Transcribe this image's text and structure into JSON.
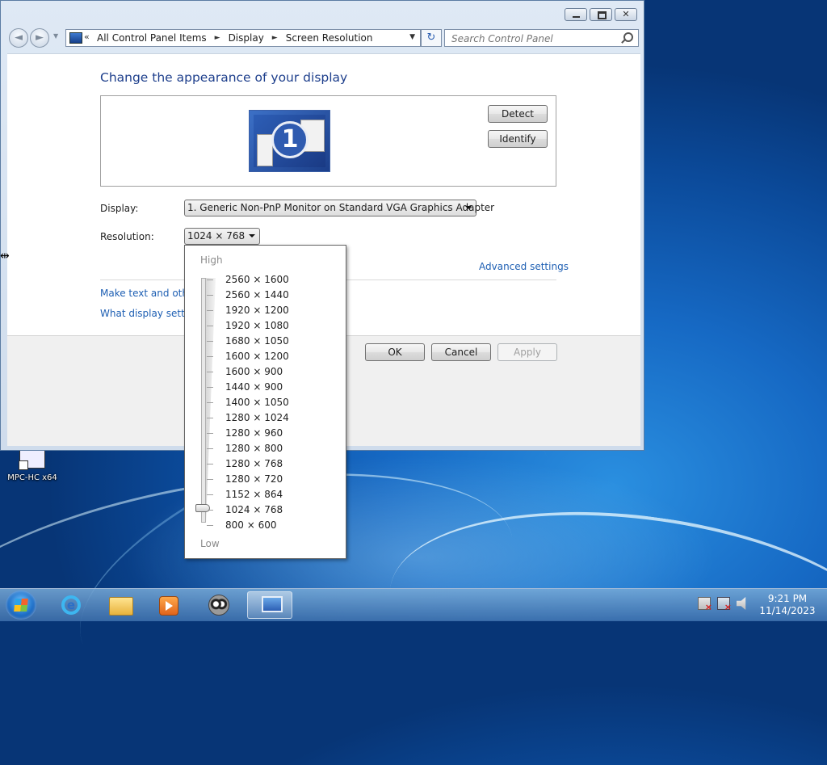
{
  "window": {
    "address": {
      "back_glyph": "◄",
      "forward_glyph": "►",
      "chevron": "«",
      "crumbs": [
        "All Control Panel Items",
        "Display",
        "Screen Resolution"
      ],
      "separator": "►",
      "refresh_glyph": "↻"
    },
    "search": {
      "placeholder": "Search Control Panel"
    },
    "title": "Change the appearance of your display",
    "monitor_number": "1",
    "detect_label": "Detect",
    "identify_label": "Identify",
    "display_label": "Display:",
    "display_value": "1. Generic Non-PnP Monitor on Standard VGA Graphics Adapter",
    "resolution_label": "Resolution:",
    "resolution_value": "1024 × 768",
    "advanced_link": "Advanced settings",
    "link_text_size": "Make text and other",
    "link_what_settings": "What display setting",
    "ok_label": "OK",
    "cancel_label": "Cancel",
    "apply_label": "Apply"
  },
  "resolution_dropdown": {
    "high_label": "High",
    "low_label": "Low",
    "options": [
      "2560 × 1600",
      "2560 × 1440",
      "1920 × 1200",
      "1920 × 1080",
      "1680 × 1050",
      "1600 × 1200",
      "1600 × 900",
      "1440 × 900",
      "1400 × 1050",
      "1280 × 1024",
      "1280 × 960",
      "1280 × 800",
      "1280 × 768",
      "1280 × 720",
      "1152 × 864",
      "1024 × 768",
      "800 × 600"
    ],
    "selected": "1024 × 768"
  },
  "desktop": {
    "icon_label": "MPC-HC x64"
  },
  "taskbar": {
    "items": [
      "start-button",
      "internet-explorer-icon",
      "file-explorer-icon",
      "media-player-icon",
      "raccoon-app-icon",
      "display-settings-icon"
    ],
    "time": "9:21 PM",
    "date": "11/14/2023"
  },
  "colors": {
    "title_blue": "#1e3f8c",
    "link_blue": "#1e5fb3",
    "desktop_blue": "#1669c4"
  }
}
